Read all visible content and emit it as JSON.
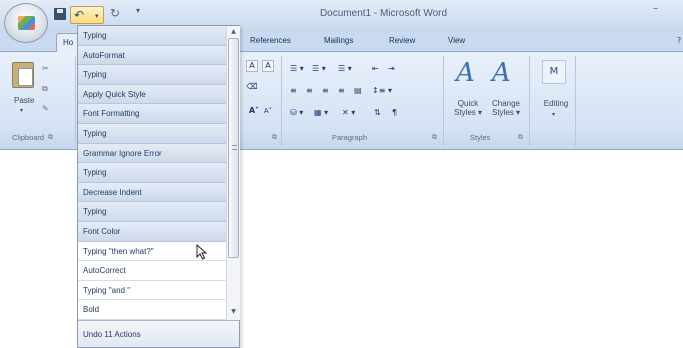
{
  "window": {
    "title": "Document1 - Microsoft Word",
    "minimize_glyph": "–"
  },
  "quick_access": {
    "save_icon": "save-icon",
    "undo_glyph": "↶",
    "undo_dropdown_glyph": "▾",
    "redo_glyph": "↻",
    "customize_glyph": "▾"
  },
  "tabs": {
    "home": "Ho",
    "references": "References",
    "mailings": "Mailings",
    "review": "Review",
    "view": "View",
    "help_glyph": "?"
  },
  "ribbon": {
    "clipboard": {
      "paste_label": "Paste",
      "paste_arrow": "▾",
      "group_label": "Clipboard",
      "cut_glyph": "✂",
      "copy_glyph": "⧉",
      "painter_glyph": "✎",
      "launcher_glyph": "⧉"
    },
    "font": {
      "highlight_glyph": "A",
      "color_glyph": "A",
      "eraser_glyph": "⌫",
      "grow_glyph": "A˄",
      "shrink_glyph": "A˅",
      "launcher_glyph": "⧉"
    },
    "paragraph": {
      "bullets": "☰ ▾",
      "numbering": "☰ ▾",
      "multilevel": "☰ ▾",
      "decrease_indent": "⇤",
      "increase_indent": "⇥",
      "align_left": "≡",
      "align_center": "≡",
      "align_right": "≡",
      "justify": "≡",
      "distributed": "▤",
      "line_spacing": "↕≡ ▾",
      "shading": "⛁ ▾",
      "borders": "▦ ▾",
      "asian_layout": "✕ ▾",
      "sort": "⇅",
      "show_marks": "¶",
      "group_label": "Paragraph",
      "launcher_glyph": "⧉"
    },
    "styles": {
      "quick_styles_label": "Quick Styles ▾",
      "change_styles_label": "Change Styles ▾",
      "icon_glyph": "A",
      "group_label": "Styles",
      "launcher_glyph": "⧉"
    },
    "editing": {
      "label": "Editing",
      "icon_glyph": "M",
      "arrow": "▾"
    }
  },
  "undo_list": {
    "items": [
      "Typing",
      "AutoFormat",
      "Typing",
      "Apply Quick Style",
      "Font Formatting",
      "Typing",
      "Grammar Ignore Error",
      "Typing",
      "Decrease Indent",
      "Typing",
      "Font Color",
      "Typing \"then what?\"",
      "AutoCorrect",
      "Typing \"and \"",
      "Bold"
    ],
    "selected_count": 11,
    "footer": "Undo 11 Actions",
    "scroll_up_glyph": "▲",
    "scroll_down_glyph": "▼"
  }
}
